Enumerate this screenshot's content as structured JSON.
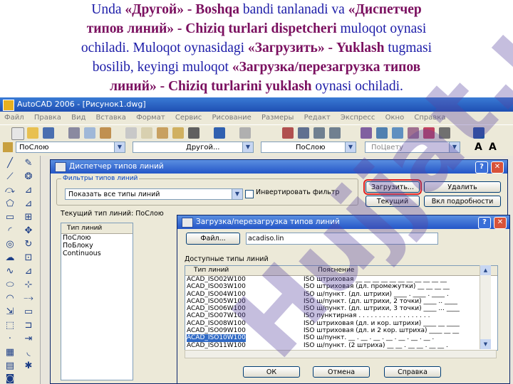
{
  "caption": {
    "l1a": "Unda ",
    "l1b": "«Другой» - Boshqa",
    "l1c": " bandi tanlanadi va ",
    "l1d": "«Диспетчер",
    "l2a": "типов линий» - Chiziq turlari dispetcheri",
    "l2b": " muloqot oynasi",
    "l3a": "ochiladi. Muloqot oynasidagi ",
    "l3b": "«Загрузить» - Yuklash",
    "l3c": " tugmasi",
    "l4a": "bosilib, keyingi muloqot ",
    "l4b": "«Загрузка/перезагрузка типов",
    "l5a": "линий» - Chiziq turlarini yuklash",
    "l5b": "  oynasi ochiladi."
  },
  "acad": {
    "title": "AutoCAD 2006 - [Рисунок1.dwg]",
    "menu": [
      "Файл",
      "Правка",
      "Вид",
      "Вставка",
      "Формат",
      "Сервис",
      "Рисование",
      "Размеры",
      "Редакт",
      "Экспресс",
      "Окно",
      "Справка"
    ],
    "layer_combo": "ПоСлою",
    "linetype_combo": "Другой...",
    "lineweight_combo": "ПоСлою",
    "color_combo": "ПоЦвету",
    "text_tool_a": "A"
  },
  "dialog1": {
    "title": "Диспетчер типов линий",
    "filter_group": "Фильтры типов линий",
    "filter_value": "Показать все типы линий",
    "invert_label": "Инвертировать фильтр",
    "load_button": "Загрузить...",
    "delete_button": "Удалить",
    "current_button": "Текущий",
    "details_button": "Вкл подробности",
    "current_type": "Текущий тип линий: ПоСлою",
    "list_header": "Тип линий",
    "list_items": [
      "ПоСлою",
      "ПоБлоку",
      "Continuous"
    ]
  },
  "dialog2": {
    "title": "Загрузка/перезагрузка типов линий",
    "file_button": "Файл...",
    "file_value": "acadiso.lin",
    "available_label": "Доступные типы линий",
    "col_type": "Тип линий",
    "col_desc": "Пояснение",
    "rows": [
      {
        "name": "ACAD_ISO02W100",
        "desc": "ISO штриховая __ __ __ __ __ __ __ __ __ __ __"
      },
      {
        "name": "ACAD_ISO03W100",
        "desc": "ISO штриховая (дл. промежутки) __ __ __ __"
      },
      {
        "name": "ACAD_ISO04W100",
        "desc": "ISO ш/пункт. (дл. штрихи) ____ . ____ . ____ ."
      },
      {
        "name": "ACAD_ISO05W100",
        "desc": "ISO ш/пункт. (дл. штрихи, 2 точки) ____ .. ____"
      },
      {
        "name": "ACAD_ISO06W100",
        "desc": "ISO ш/пункт. (дл. штрихи, 3 точки) ____ ... ____"
      },
      {
        "name": "ACAD_ISO07W100",
        "desc": "ISO пунктирная . . . . . . . . . . . . . . . . . ."
      },
      {
        "name": "ACAD_ISO08W100",
        "desc": "ISO штриховая (дл. и кор. штрихи) ____ __ ____"
      },
      {
        "name": "ACAD_ISO09W100",
        "desc": "ISO штриховая (дл. и 2 кор. штриха) ____ __ __"
      },
      {
        "name": "ACAD_ISO10W100",
        "desc": "ISO ш/пункт. __ . __ . __ . __ . __ . __ . __ ."
      },
      {
        "name": "ACAD_ISO11W100",
        "desc": "ISO ш/пункт. (2 штриха) __ __ . __ __ . __ __ ."
      }
    ],
    "selected_row": 8,
    "ok_button": "ОК",
    "cancel_button": "Отмена",
    "help_button": "Справка"
  },
  "watermark": "Hujjat.uz",
  "colors": {
    "title_blue": "#1c1ca8",
    "bold_purple": "#7a0f5f",
    "xp_title": "#2456c8",
    "highlight_red": "#e02020",
    "select": "#316ac5"
  }
}
